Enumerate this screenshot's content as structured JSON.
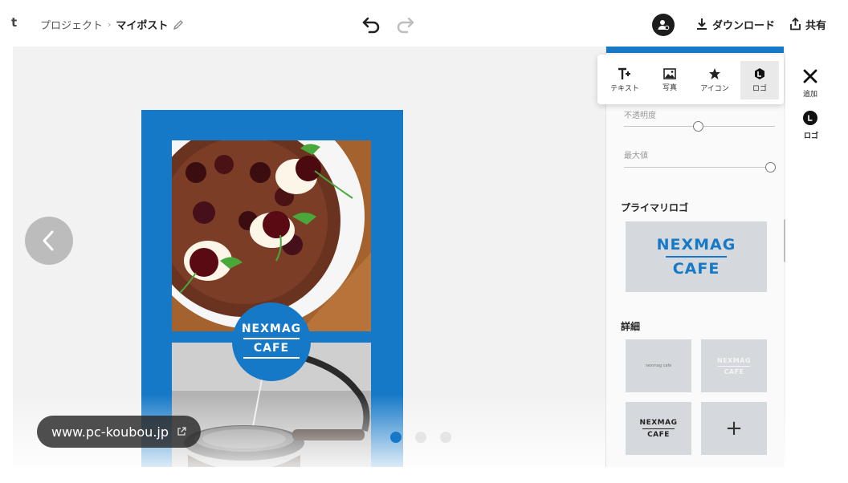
{
  "header": {
    "breadcrumb_edge": "t",
    "breadcrumb_parent": "プロジェクト",
    "breadcrumb_separator": "›",
    "breadcrumb_current": "マイポスト",
    "download_label": "ダウンロード",
    "share_label": "共有"
  },
  "poster": {
    "logo_line1": "NEXMAG",
    "logo_line2": "CAFE"
  },
  "panel": {
    "opacity_label": "不透明度",
    "size_label": "最大値",
    "opacity_value": 0.49,
    "size_value": 0.97,
    "primary_logo_title": "プライマリロゴ",
    "primary_logo_line1": "NEXMAG",
    "primary_logo_line2": "CAFE",
    "details_title": "詳細",
    "detail_tile1_text": "nexmag cafe",
    "detail_tile2_line1": "NEXMAG",
    "detail_tile2_line2": "CAFE",
    "detail_tile3_line1": "NEXMAG",
    "detail_tile3_line2": "CAFE",
    "detail_add_label": "+"
  },
  "add_popup": {
    "items": [
      {
        "label": "テキスト",
        "icon": "text-add-icon"
      },
      {
        "label": "写真",
        "icon": "photo-icon"
      },
      {
        "label": "アイコン",
        "icon": "star-icon"
      },
      {
        "label": "ロゴ",
        "icon": "logo-icon"
      }
    ],
    "selected": "ロゴ"
  },
  "rail": {
    "close_label": "追加",
    "logo_label": "ロゴ"
  },
  "pager": {
    "page_count": 3,
    "active_index": 0
  },
  "url_pill": {
    "text": "www.pc-koubou.jp"
  },
  "colors": {
    "brand_blue": "#1679c8",
    "canvas_bg": "#f2f2f2",
    "tile_gray": "#d5d8dc"
  }
}
